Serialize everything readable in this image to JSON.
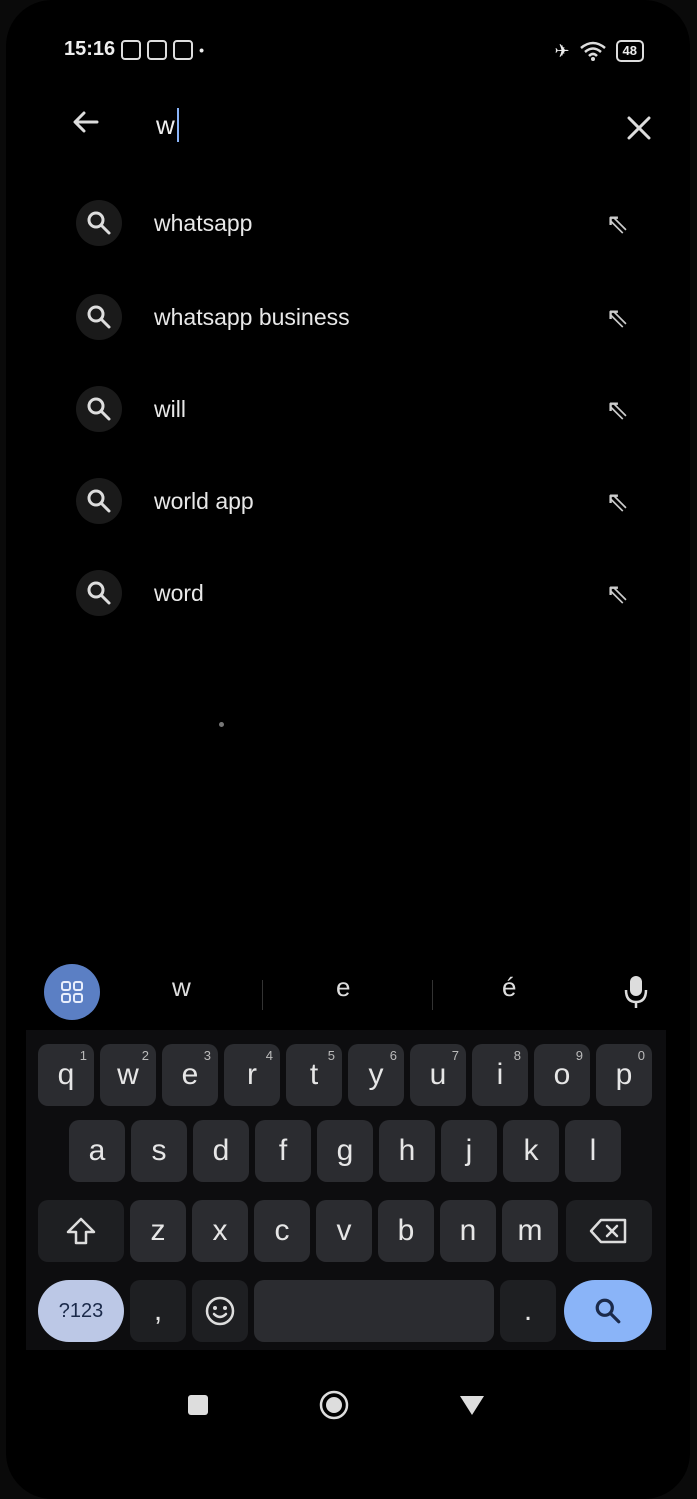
{
  "status_bar": {
    "time": "15:16",
    "battery": "48"
  },
  "search": {
    "query": "w"
  },
  "suggestions": [
    {
      "label": "whatsapp"
    },
    {
      "label": "whatsapp business"
    },
    {
      "label": "will"
    },
    {
      "label": "world app"
    },
    {
      "label": "word"
    }
  ],
  "suggestion_strip": {
    "chips": [
      "w",
      "e",
      "é"
    ]
  },
  "keyboard": {
    "row1": [
      {
        "k": "q",
        "n": "1"
      },
      {
        "k": "w",
        "n": "2"
      },
      {
        "k": "e",
        "n": "3"
      },
      {
        "k": "r",
        "n": "4"
      },
      {
        "k": "t",
        "n": "5"
      },
      {
        "k": "y",
        "n": "6"
      },
      {
        "k": "u",
        "n": "7"
      },
      {
        "k": "i",
        "n": "8"
      },
      {
        "k": "o",
        "n": "9"
      },
      {
        "k": "p",
        "n": "0"
      }
    ],
    "row2": [
      "a",
      "s",
      "d",
      "f",
      "g",
      "h",
      "j",
      "k",
      "l"
    ],
    "row3": [
      "z",
      "x",
      "c",
      "v",
      "b",
      "n",
      "m"
    ],
    "symbols_label": "?123",
    "comma": ",",
    "period": "."
  }
}
